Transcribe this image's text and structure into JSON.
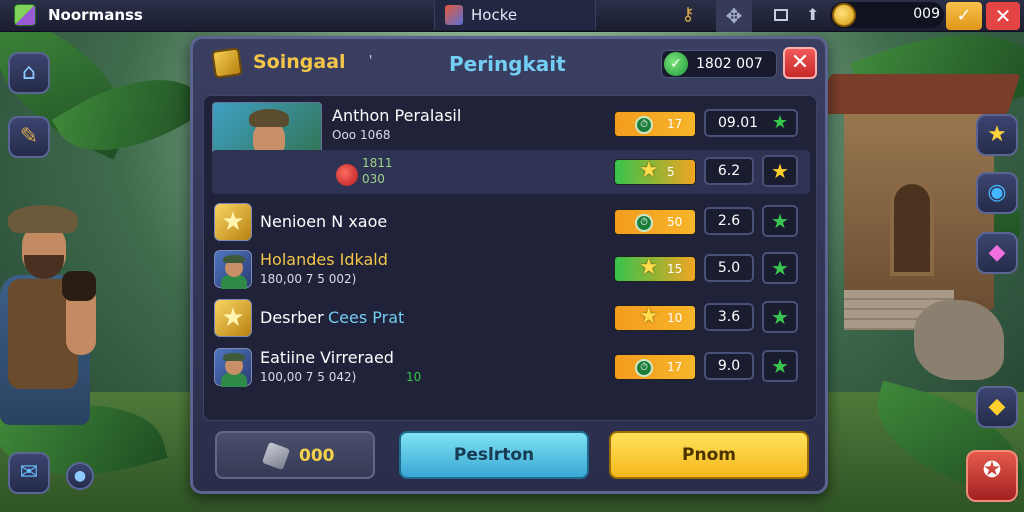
{
  "topbar": {
    "app_title": "Noormanss",
    "tab_title": "Hocke",
    "coin_value": "009",
    "minimize_glyph": "✓",
    "close_glyph": "✕"
  },
  "panel": {
    "left_title": "Soingaal",
    "quote_mark": "'",
    "center_title": "Peringkait",
    "currency_value": "1802 007",
    "currency_check": "✓",
    "close_glyph": "✕"
  },
  "rows": [
    {
      "name": "Anthon Peralasil",
      "sub": "Ooo 1068",
      "sub2": "1811",
      "sub3": "030",
      "pill": "17",
      "pill_type": "orange",
      "score": "09.01",
      "score_has_star": true
    },
    {
      "pill": "5",
      "pill_type": "green",
      "score": "6.2"
    },
    {
      "name": "Nenioen N xaoe",
      "pill": "50",
      "pill_type": "orange",
      "score": "2.6"
    },
    {
      "name": "Holandes Idkald",
      "sub": "180,00 7 5 002)",
      "pill": "15",
      "pill_type": "green",
      "score": "5.0"
    },
    {
      "name_a": "Desrber",
      "name_b": "Cees Prat",
      "pill": "10",
      "pill_type": "orange",
      "score": "3.6"
    },
    {
      "name": "Eatiine Virreraed",
      "sub": "100,00 7 5 042)",
      "sub_extra": "10",
      "pill": "17",
      "pill_type": "orange",
      "score": "9.0"
    }
  ],
  "footer": {
    "gray_label": "000",
    "blue_label": "Peslrton",
    "yellow_label": "Pnom"
  },
  "colors": {
    "accent_gold": "#f3c64a",
    "accent_blue": "#74cdf3",
    "close_red": "#e54444",
    "star_green": "#37c84b"
  },
  "icons": {
    "home": "home-icon",
    "map": "scroll-map-icon",
    "star": "star-icon",
    "shield": "blue-shield-icon",
    "gem": "pink-gem-icon",
    "diamond": "yellow-diamond-icon",
    "chat": "chat-icon",
    "settings_orb": "orb-icon",
    "backpack": "backpack-icon"
  }
}
